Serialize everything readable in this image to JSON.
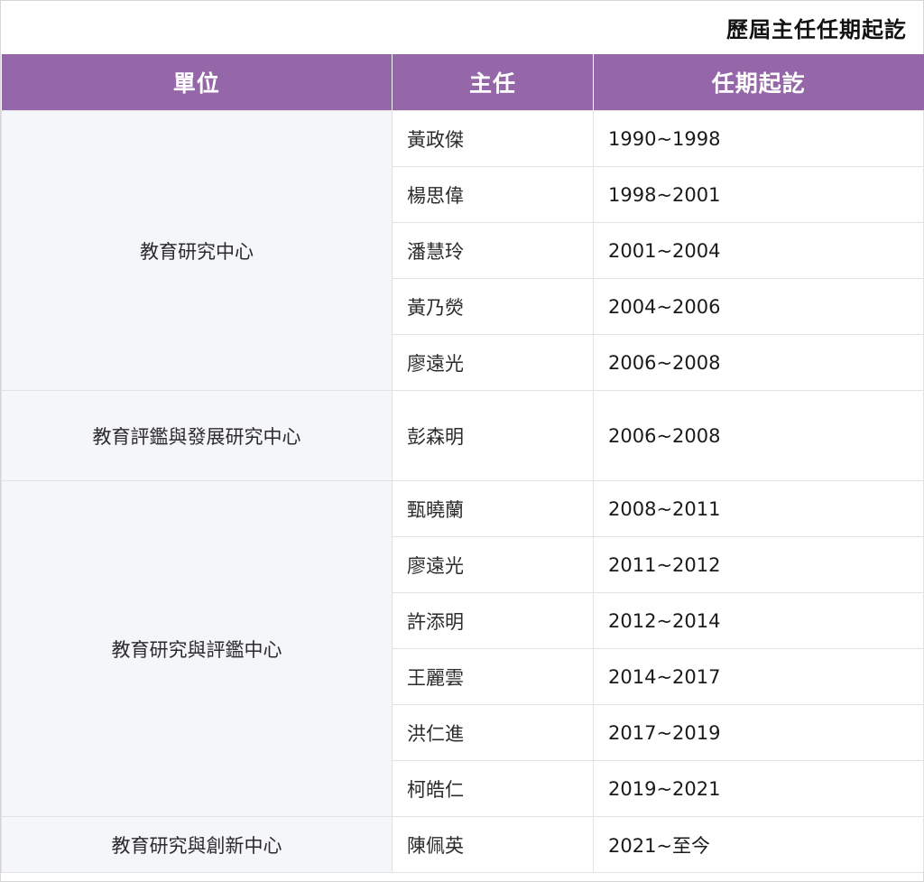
{
  "title": "歷屆主任任期起訖",
  "columns": {
    "unit": "單位",
    "director": "主任",
    "term": "任期起訖"
  },
  "groups": [
    {
      "unit": "教育研究中心",
      "rows": [
        {
          "director": "黃政傑",
          "term": "1990~1998"
        },
        {
          "director": "楊思偉",
          "term": "1998~2001"
        },
        {
          "director": "潘慧玲",
          "term": "2001~2004"
        },
        {
          "director": "黃乃熒",
          "term": "2004~2006"
        },
        {
          "director": "廖遠光",
          "term": "2006~2008"
        }
      ]
    },
    {
      "unit": "教育評鑑與發展研究中心",
      "rows": [
        {
          "director": "彭森明",
          "term": "2006~2008"
        }
      ]
    },
    {
      "unit": "教育研究與評鑑中心",
      "rows": [
        {
          "director": "甄曉蘭",
          "term": "2008~2011"
        },
        {
          "director": "廖遠光",
          "term": "2011~2012"
        },
        {
          "director": "許添明",
          "term": "2012~2014"
        },
        {
          "director": "王麗雲",
          "term": "2014~2017"
        },
        {
          "director": "洪仁進",
          "term": "2017~2019"
        },
        {
          "director": "柯皓仁",
          "term": "2019~2021"
        }
      ]
    },
    {
      "unit": "教育研究與創新中心",
      "rows": [
        {
          "director": "陳佩英",
          "term": "2021~至今"
        }
      ]
    }
  ]
}
